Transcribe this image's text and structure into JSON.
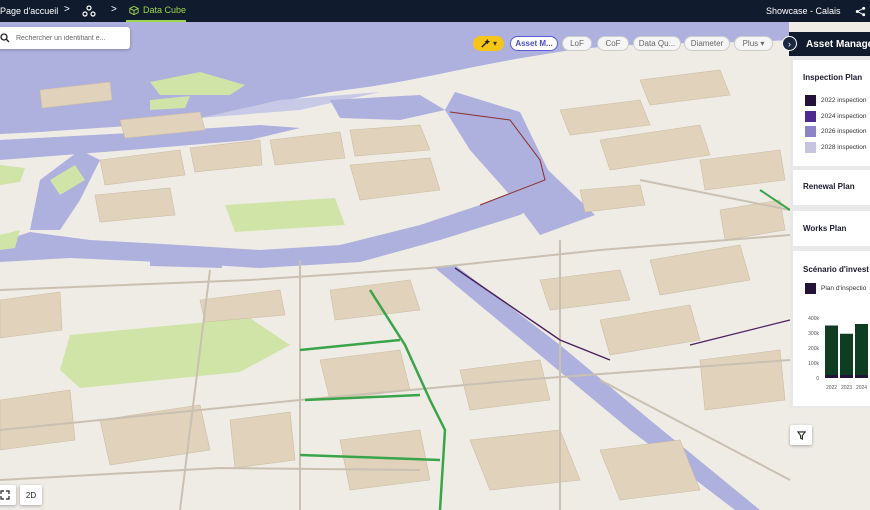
{
  "topbar": {
    "home_label": "Page d'accueil",
    "separator": ">",
    "active_tab_label": "Data Cube",
    "project_label": "Showcase - Calais"
  },
  "search": {
    "placeholder": "Rechercher un identifiant e..."
  },
  "chips": {
    "tool_label": "▾",
    "items": [
      "Asset M...",
      "LoF",
      "CoF",
      "Data Qu...",
      "Diameter",
      "Plus ▾"
    ]
  },
  "panel": {
    "title": "Asset Managem",
    "inspection_plan": {
      "title": "Inspection Plan",
      "legend": [
        {
          "label": "2022 inspection",
          "color": "#231338"
        },
        {
          "label": "2024 inspection",
          "color": "#4e2a8e"
        },
        {
          "label": "2026 inspection",
          "color": "#8c84c6"
        },
        {
          "label": "2028 inspection",
          "color": "#c6c4e0"
        }
      ]
    },
    "renewal_plan": {
      "title": "Renewal Plan"
    },
    "works_plan": {
      "title": "Works Plan"
    },
    "scenario": {
      "title": "Scénario d'invest",
      "legend": [
        {
          "label": "Plan d'inspectio",
          "color": "#231338"
        }
      ]
    }
  },
  "chart_data": {
    "type": "bar",
    "categories": [
      "2022",
      "2023",
      "2024"
    ],
    "series": [
      {
        "values": [
          20000,
          20000,
          20000
        ],
        "color": "#231338"
      },
      {
        "values": [
          330000,
          275000,
          340000
        ],
        "color": "#0e3d22"
      }
    ],
    "yticks": [
      "400k",
      "300k",
      "200k",
      "100k",
      "0"
    ],
    "ylim": [
      0,
      400000
    ]
  },
  "controls": {
    "view_2d_label": "2D"
  },
  "colors": {
    "water": "#aeb0dd",
    "park": "#cfe4a6",
    "building": "#e1d2bc",
    "network": "#3aa44a",
    "topbar": "#101b2e"
  }
}
